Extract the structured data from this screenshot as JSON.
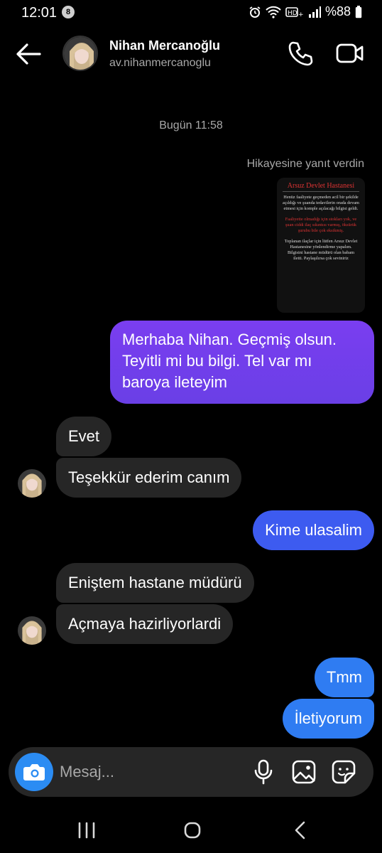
{
  "status_bar": {
    "time": "12:01",
    "notification_count": "8",
    "battery": "%88"
  },
  "header": {
    "contact_name": "Nihan Mercanoğlu",
    "contact_username": "av.nihanmercanoglu"
  },
  "chat": {
    "timestamp": "Bugün 11:58",
    "story_reply_label": "Hikayesine yanıt verdin",
    "story": {
      "title": "Arsuz Devlet Hastanesi",
      "paragraph1": "Henüz faaliyete geçmeden acil bir şekilde açıldığı ve şuanda tedavilerin orada devam etmesi için komple açılacağı bilgisi geldi.",
      "paragraph2": "Faaliyette olmadığı için stokları yok, ve şuan ciddi ilaç sıkıntısı varmış, öksürük şurubu bile çok eksikmiş.",
      "paragraph3": "Toplanan ilaçlar için lütfen Arsuz Devlet Hastanesine yönlendirme yapalım. Bilgisini hastane müdürü olan babam iletti. Paylaşılırsa çok seviniriz"
    },
    "messages": [
      {
        "from": "me",
        "text": "Merhaba Nihan. Geçmiş olsun. Teyitli mi bu bilgi. Tel var mı baroya ileteyim"
      },
      {
        "from": "them",
        "text": "Evet"
      },
      {
        "from": "them",
        "text": "Teşekkür ederim canım"
      },
      {
        "from": "me",
        "text": "Kime ulasalim"
      },
      {
        "from": "them",
        "text": "Eniştem hastane müdürü"
      },
      {
        "from": "them",
        "text": "Açmaya hazirliyorlardi"
      },
      {
        "from": "me",
        "text": "Tmm"
      },
      {
        "from": "me",
        "text": "İletiyorum"
      }
    ]
  },
  "composer": {
    "placeholder": "Mesaj..."
  },
  "colors": {
    "background": "#000000",
    "incoming_bubble": "#262626",
    "outgoing_purple": "#6a3fe6",
    "outgoing_indigo": "#3d5bf0",
    "outgoing_blue": "#2f7cf2",
    "camera_button": "#2b8cf3",
    "secondary_text": "#a8a8a8"
  },
  "icons": {
    "back": "arrow-left-icon",
    "call": "phone-icon",
    "video": "video-camera-icon",
    "camera": "camera-icon",
    "mic": "microphone-icon",
    "gallery": "image-icon",
    "sticker": "sticker-icon"
  }
}
